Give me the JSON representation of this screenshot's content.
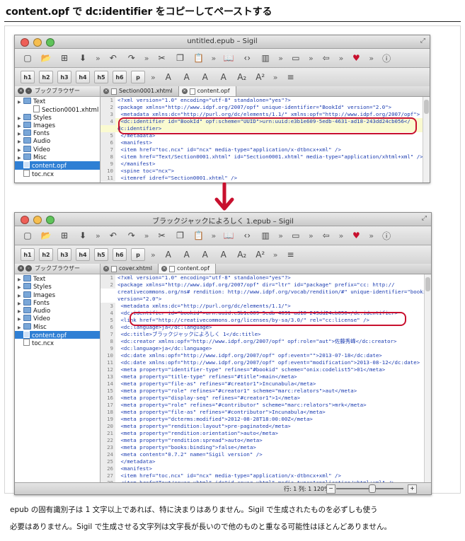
{
  "heading": "content.opf で dc:identifier をコピーしてペーストする",
  "top_window": {
    "title": "untitled.epub – Sigil",
    "panel_title": "ブックブラウザー",
    "tree": [
      {
        "label": "Text",
        "kind": "folder"
      },
      {
        "label": "Section0001.xhtml",
        "kind": "file",
        "indent": 1
      },
      {
        "label": "Styles",
        "kind": "folder"
      },
      {
        "label": "Images",
        "kind": "folder"
      },
      {
        "label": "Fonts",
        "kind": "folder"
      },
      {
        "label": "Audio",
        "kind": "folder"
      },
      {
        "label": "Video",
        "kind": "folder"
      },
      {
        "label": "Misc",
        "kind": "folder"
      },
      {
        "label": "content.opf",
        "kind": "file",
        "selected": true
      },
      {
        "label": "toc.ncx",
        "kind": "file"
      }
    ],
    "tabs": [
      "Section0001.xhtml",
      "content.opf"
    ],
    "code": [
      {
        "n": "1",
        "t": "<?xml version=\"1.0\" encoding=\"utf-8\" standalone=\"yes\"?>"
      },
      {
        "n": "2",
        "t": "<package xmlns=\"http://www.idpf.org/2007/opf\" unique-identifier=\"BookId\" version=\"2.0\">"
      },
      {
        "n": "3",
        "t": "  <metadata xmlns:dc=\"http://purl.org/dc/elements/1.1/\" xmlns:opf=\"http://www.idpf.org/2007/opf\">"
      },
      {
        "n": "4",
        "t": "    <dc:identifier id=\"BookId\" opf:scheme=\"UUID\">urn:uuid:e3b1e609-5edb-4631-ad18-243dd24cb056</",
        "hl": true
      },
      {
        "n": "",
        "t": "dc:identifier>",
        "hl": true
      },
      {
        "n": "5",
        "t": "  </metadata>"
      },
      {
        "n": "6",
        "t": "  <manifest>"
      },
      {
        "n": "7",
        "t": "    <item href=\"toc.ncx\" id=\"ncx\" media-type=\"application/x-dtbncx+xml\" />"
      },
      {
        "n": "8",
        "t": "    <item href=\"Text/Section0001.xhtml\" id=\"Section0001.xhtml\" media-type=\"application/xhtml+xml\" />"
      },
      {
        "n": "9",
        "t": "  </manifest>"
      },
      {
        "n": "10",
        "t": "  <spine toc=\"ncx\">"
      },
      {
        "n": "11",
        "t": "    <itemref idref=\"Section0001.xhtml\" />"
      }
    ]
  },
  "bottom_window": {
    "title": "ブラックジャックによろしく 1.epub – Sigil",
    "panel_title": "ブックブラウザー",
    "tree": [
      {
        "label": "Text",
        "kind": "folder"
      },
      {
        "label": "Styles",
        "kind": "folder"
      },
      {
        "label": "Images",
        "kind": "folder"
      },
      {
        "label": "Fonts",
        "kind": "folder"
      },
      {
        "label": "Audio",
        "kind": "folder"
      },
      {
        "label": "Video",
        "kind": "folder"
      },
      {
        "label": "Misc",
        "kind": "folder"
      },
      {
        "label": "content.opf",
        "kind": "file",
        "selected": true
      },
      {
        "label": "toc.ncx",
        "kind": "file"
      }
    ],
    "tabs": [
      "cover.xhtml",
      "content.opf"
    ],
    "code": [
      {
        "n": "1",
        "t": "<?xml version=\"1.0\" encoding=\"utf-8\" standalone=\"yes\"?>"
      },
      {
        "n": "2",
        "t": "<package xmlns=\"http://www.idpf.org/2007/opf\" dir=\"ltr\" id=\"package\" prefix=\"cc: http://"
      },
      {
        "n": "",
        "t": "creativecommons.org/ns# rendition: http://www.idpf.org/vocab/rendition/#\" unique-identifier=\"bookid\""
      },
      {
        "n": "",
        "t": "version=\"2.0\">"
      },
      {
        "n": "3",
        "t": "  <metadata xmlns:dc=\"http://purl.org/dc/elements/1.1/\">"
      },
      {
        "n": "4",
        "t": "    <dc:identifier id=\"bookid\">urn:uuid:e3b1e609-5edb-4631-ad18-243dd24cb056</dc:identifier>"
      },
      {
        "n": "5",
        "t": "    <link href=\"http://creativecommons.org/licenses/by-sa/3.0/\" rel=\"cc:license\" />"
      },
      {
        "n": "6",
        "t": "    <dc:language>ja</dc:language>"
      },
      {
        "n": "7",
        "t": "    <dc:title>ブラックジャックによろしく 1</dc:title>"
      },
      {
        "n": "8",
        "t": "    <dc:creator xmlns:opf=\"http://www.idpf.org/2007/opf\" opf:role=\"aut\">佐藤秀峰</dc:creator>"
      },
      {
        "n": "9",
        "t": "    <dc:language>ja</dc:language>"
      },
      {
        "n": "10",
        "t": "    <dc:date xmlns:opf=\"http://www.idpf.org/2007/opf\" opf:event=\"\">2013-07-18</dc:date>"
      },
      {
        "n": "11",
        "t": "    <dc:date xmlns:opf=\"http://www.idpf.org/2007/opf\" opf:event=\"modification\">2013-08-12</dc:date>"
      },
      {
        "n": "12",
        "t": "    <meta property=\"identifier-type\" refines=\"#bookid\" scheme=\"onix:codelist5\">01</meta>"
      },
      {
        "n": "13",
        "t": "    <meta property=\"title-type\" refines=\"#title\">main</meta>"
      },
      {
        "n": "14",
        "t": "    <meta property=\"file-as\" refines=\"#creator1\">Incunabula</meta>"
      },
      {
        "n": "15",
        "t": "    <meta property=\"role\" refines=\"#creator1\" scheme=\"marc:relators\">aut</meta>"
      },
      {
        "n": "16",
        "t": "    <meta property=\"display-seq\" refines=\"#creator1\">1</meta>"
      },
      {
        "n": "17",
        "t": "    <meta property=\"role\" refines=\"#contributor\" scheme=\"marc:relators\">mrk</meta>"
      },
      {
        "n": "18",
        "t": "    <meta property=\"file-as\" refines=\"#contributor\">Incunabula</meta>"
      },
      {
        "n": "19",
        "t": "    <meta property=\"dcterms:modified\">2012-08-28T18:00:00Z</meta>"
      },
      {
        "n": "20",
        "t": "    <meta property=\"rendition:layout\">pre-paginated</meta>"
      },
      {
        "n": "21",
        "t": "    <meta property=\"rendition:orientation\">auto</meta>"
      },
      {
        "n": "22",
        "t": "    <meta property=\"rendition:spread\">auto</meta>"
      },
      {
        "n": "23",
        "t": "    <meta property=\"books:binding\">false</meta>"
      },
      {
        "n": "24",
        "t": "    <meta content=\"0.7.2\" name=\"Sigil version\" />"
      },
      {
        "n": "25",
        "t": "  </metadata>"
      },
      {
        "n": "26",
        "t": "  <manifest>"
      },
      {
        "n": "27",
        "t": "    <item href=\"toc.ncx\" id=\"ncx\" media-type=\"application/x-dtbncx+xml\" />"
      },
      {
        "n": "28",
        "t": "    <item href=\"Text/cover.xhtml\" id=\"id-cover-xhtml\" media-type=\"application/xhtml+xml\" />"
      }
    ],
    "status_position": "行: 1 列: 1 120%"
  },
  "toolbar_row2": [
    "h1",
    "h2",
    "h3",
    "h4",
    "h5",
    "h6",
    "p"
  ],
  "caption_lines": [
    "epub の固有識別子は 1 文字以上であれば、特に決まりはありません。Sigil で生成されたものを必ずしも使う",
    "必要はありません。Sigil で生成させる文字列は文字長が長いので他のものと重なる可能性はほとんどありません。"
  ],
  "colors": {
    "callout": "#c8102e",
    "arrow": "#c8102e",
    "selection": "#2f7fd4",
    "code_text": "#1a3bb0"
  }
}
